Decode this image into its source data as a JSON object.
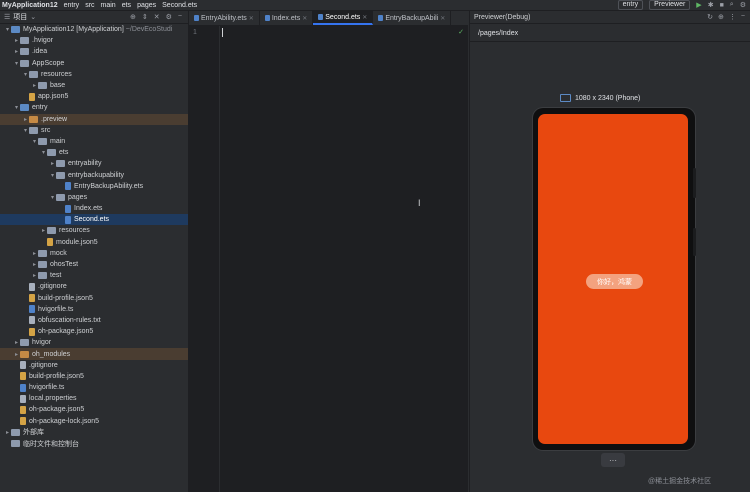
{
  "topbar": {
    "crumbs": [
      "MyApplication12",
      "entry",
      "src",
      "main",
      "ets",
      "pages",
      "Second.ets"
    ],
    "run_config": "entry",
    "device": "Previewer"
  },
  "project": {
    "title": "项目",
    "tree": [
      {
        "label": "MyApplication12 [MyApplication]",
        "hint": "~/DevEcoStudi",
        "depth": 0,
        "arrow": "down",
        "icon": "folder-blue"
      },
      {
        "label": ".hvigor",
        "depth": 1,
        "arrow": "right",
        "icon": "folder"
      },
      {
        "label": ".idea",
        "depth": 1,
        "arrow": "right",
        "icon": "folder"
      },
      {
        "label": "AppScope",
        "depth": 1,
        "arrow": "down",
        "icon": "folder"
      },
      {
        "label": "resources",
        "depth": 2,
        "arrow": "down",
        "icon": "folder"
      },
      {
        "label": "base",
        "depth": 3,
        "arrow": "right",
        "icon": "folder"
      },
      {
        "label": "app.json5",
        "depth": 2,
        "arrow": "",
        "icon": "file-json"
      },
      {
        "label": "entry",
        "depth": 1,
        "arrow": "down",
        "icon": "folder-blue"
      },
      {
        "label": ".preview",
        "depth": 2,
        "arrow": "right",
        "icon": "folder-orange",
        "highlight": true
      },
      {
        "label": "src",
        "depth": 2,
        "arrow": "down",
        "icon": "folder"
      },
      {
        "label": "main",
        "depth": 3,
        "arrow": "down",
        "icon": "folder"
      },
      {
        "label": "ets",
        "depth": 4,
        "arrow": "down",
        "icon": "folder"
      },
      {
        "label": "entryability",
        "depth": 5,
        "arrow": "right",
        "icon": "folder"
      },
      {
        "label": "entrybackupability",
        "depth": 5,
        "arrow": "down",
        "icon": "folder"
      },
      {
        "label": "EntryBackupAbility.ets",
        "depth": 6,
        "arrow": "",
        "icon": "file-ts"
      },
      {
        "label": "pages",
        "depth": 5,
        "arrow": "down",
        "icon": "folder"
      },
      {
        "label": "Index.ets",
        "depth": 6,
        "arrow": "",
        "icon": "file-ts"
      },
      {
        "label": "Second.ets",
        "depth": 6,
        "arrow": "",
        "icon": "file-ts",
        "selected": true
      },
      {
        "label": "resources",
        "depth": 4,
        "arrow": "right",
        "icon": "folder"
      },
      {
        "label": "module.json5",
        "depth": 4,
        "arrow": "",
        "icon": "file-json"
      },
      {
        "label": "mock",
        "depth": 3,
        "arrow": "right",
        "icon": "folder"
      },
      {
        "label": "ohosTest",
        "depth": 3,
        "arrow": "right",
        "icon": "folder"
      },
      {
        "label": "test",
        "depth": 3,
        "arrow": "right",
        "icon": "folder"
      },
      {
        "label": ".gitignore",
        "depth": 2,
        "arrow": "",
        "icon": "file"
      },
      {
        "label": "build-profile.json5",
        "depth": 2,
        "arrow": "",
        "icon": "file-json"
      },
      {
        "label": "hvigorfile.ts",
        "depth": 2,
        "arrow": "",
        "icon": "file-ts"
      },
      {
        "label": "obfuscation-rules.txt",
        "depth": 2,
        "arrow": "",
        "icon": "file"
      },
      {
        "label": "oh-package.json5",
        "depth": 2,
        "arrow": "",
        "icon": "file-json"
      },
      {
        "label": "hvigor",
        "depth": 1,
        "arrow": "right",
        "icon": "folder"
      },
      {
        "label": "oh_modules",
        "depth": 1,
        "arrow": "right",
        "icon": "folder-orange",
        "highlight": true
      },
      {
        "label": ".gitignore",
        "depth": 1,
        "arrow": "",
        "icon": "file"
      },
      {
        "label": "build-profile.json5",
        "depth": 1,
        "arrow": "",
        "icon": "file-json"
      },
      {
        "label": "hvigorfile.ts",
        "depth": 1,
        "arrow": "",
        "icon": "file-ts"
      },
      {
        "label": "local.properties",
        "depth": 1,
        "arrow": "",
        "icon": "file"
      },
      {
        "label": "oh-package.json5",
        "depth": 1,
        "arrow": "",
        "icon": "file-json"
      },
      {
        "label": "oh-package-lock.json5",
        "depth": 1,
        "arrow": "",
        "icon": "file-json"
      },
      {
        "label": "外部库",
        "depth": 0,
        "arrow": "right",
        "icon": "folder"
      },
      {
        "label": "临时文件和控制台",
        "depth": 0,
        "arrow": "",
        "icon": "folder"
      }
    ]
  },
  "editor": {
    "tabs": [
      "EntryAbility.ets",
      "Index.ets",
      "Second.ets",
      "EntryBackupAbili"
    ],
    "active_tab": 2,
    "line_number": "1"
  },
  "previewer": {
    "title": "Previewer(Debug)",
    "path": "/pages/Index",
    "device_label": "1080 x 2340 (Phone)",
    "button_text": "你好，鸿蒙",
    "more_label": "···",
    "screen_color": "#e8480f"
  },
  "watermark": "@稀土掘金技术社区"
}
